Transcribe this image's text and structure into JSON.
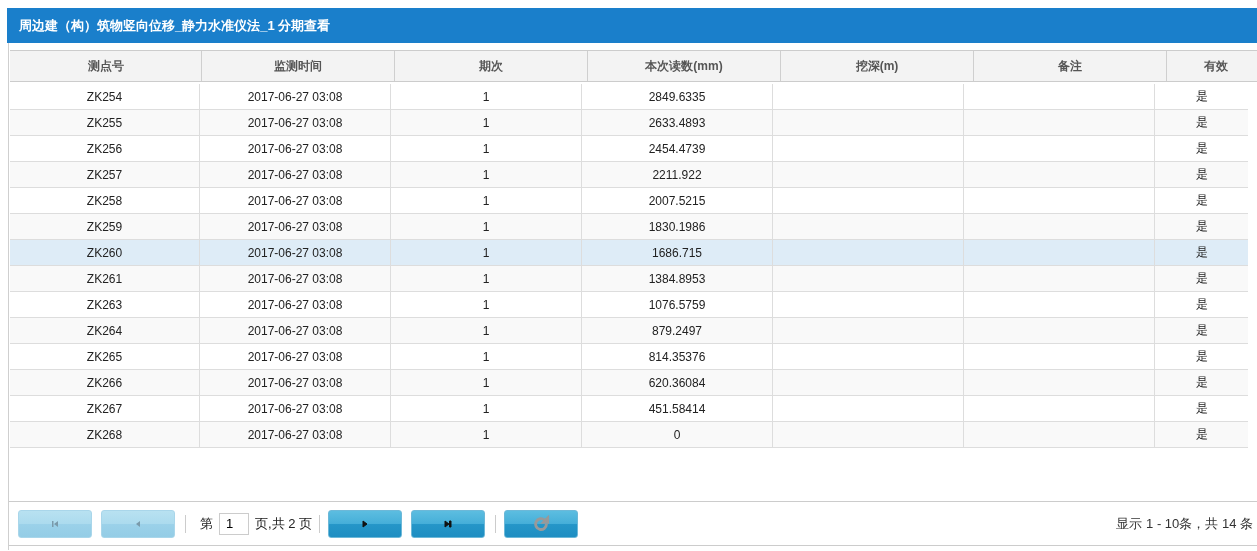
{
  "window": {
    "title": "周边建（构）筑物竖向位移_静力水准仪法_1 分期查看"
  },
  "table": {
    "columns": [
      "测点号",
      "监测时间",
      "期次",
      "本次读数(mm)",
      "挖深(m)",
      "备注",
      "有效"
    ],
    "rows": [
      {
        "cells": [
          "ZK254",
          "2017-06-27 03:08",
          "1",
          "2849.6335",
          "",
          "",
          "是"
        ],
        "selected": false
      },
      {
        "cells": [
          "ZK255",
          "2017-06-27 03:08",
          "1",
          "2633.4893",
          "",
          "",
          "是"
        ],
        "selected": false
      },
      {
        "cells": [
          "ZK256",
          "2017-06-27 03:08",
          "1",
          "2454.4739",
          "",
          "",
          "是"
        ],
        "selected": false
      },
      {
        "cells": [
          "ZK257",
          "2017-06-27 03:08",
          "1",
          "2211.922",
          "",
          "",
          "是"
        ],
        "selected": false
      },
      {
        "cells": [
          "ZK258",
          "2017-06-27 03:08",
          "1",
          "2007.5215",
          "",
          "",
          "是"
        ],
        "selected": false
      },
      {
        "cells": [
          "ZK259",
          "2017-06-27 03:08",
          "1",
          "1830.1986",
          "",
          "",
          "是"
        ],
        "selected": false
      },
      {
        "cells": [
          "ZK260",
          "2017-06-27 03:08",
          "1",
          "1686.715",
          "",
          "",
          "是"
        ],
        "selected": true
      },
      {
        "cells": [
          "ZK261",
          "2017-06-27 03:08",
          "1",
          "1384.8953",
          "",
          "",
          "是"
        ],
        "selected": false
      },
      {
        "cells": [
          "ZK263",
          "2017-06-27 03:08",
          "1",
          "1076.5759",
          "",
          "",
          "是"
        ],
        "selected": false
      },
      {
        "cells": [
          "ZK264",
          "2017-06-27 03:08",
          "1",
          "879.2497",
          "",
          "",
          "是"
        ],
        "selected": false
      },
      {
        "cells": [
          "ZK265",
          "2017-06-27 03:08",
          "1",
          "814.35376",
          "",
          "",
          "是"
        ],
        "selected": false
      },
      {
        "cells": [
          "ZK266",
          "2017-06-27 03:08",
          "1",
          "620.36084",
          "",
          "",
          "是"
        ],
        "selected": false
      },
      {
        "cells": [
          "ZK267",
          "2017-06-27 03:08",
          "1",
          "451.58414",
          "",
          "",
          "是"
        ],
        "selected": false
      },
      {
        "cells": [
          "ZK268",
          "2017-06-27 03:08",
          "1",
          "0",
          "",
          "",
          "是"
        ],
        "selected": false
      }
    ]
  },
  "pager": {
    "nav_before": [
      {
        "kind": "first",
        "disabled": true
      },
      {
        "kind": "prev",
        "disabled": true
      }
    ],
    "page_prefix": "第",
    "page": "1",
    "page_suffix": "页,共 2 页",
    "nav_after": [
      {
        "kind": "next",
        "disabled": false
      },
      {
        "kind": "last",
        "disabled": false
      }
    ],
    "refresh": {
      "kind": "refresh",
      "disabled": false
    },
    "info": "显示 1 - 10条，共 14 条"
  }
}
